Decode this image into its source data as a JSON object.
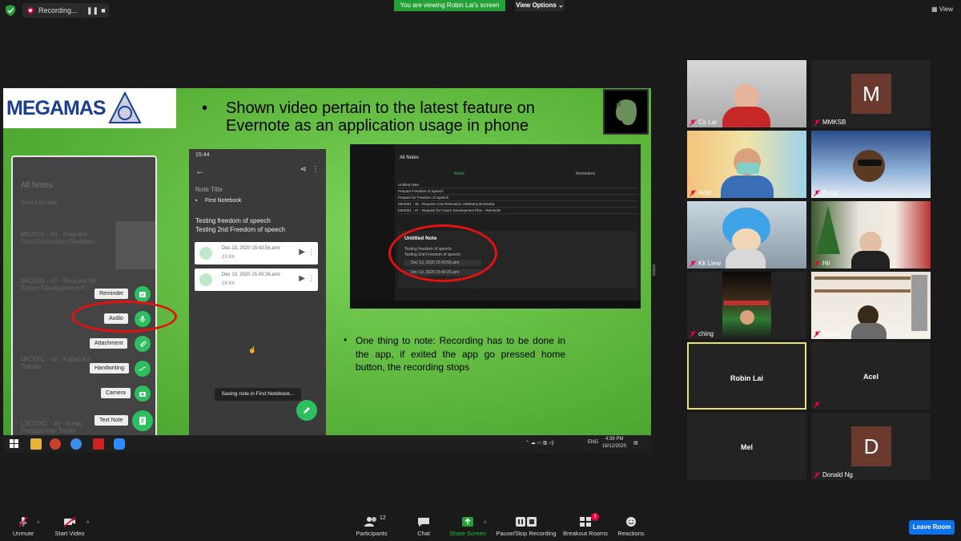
{
  "topbar": {
    "recording_label": "Recording...",
    "pause_glyph": "❚❚",
    "stop_glyph": "■",
    "viewing_banner": "You are viewing Robin Lai's screen",
    "view_options": "View Options ⌄",
    "view_label": "View"
  },
  "slide": {
    "logo_text": "MEGAMAS",
    "title_bullet": "•",
    "title_line1": "Shown video pertain to the latest feature on",
    "title_line2": "Evernote as an application usage in phone",
    "note_bullet": "•",
    "note_text": "One thing to note: Recording has to be done in the app, if exited the app go pressed home button, the recording stops",
    "left_phone": {
      "header": "All Notes",
      "sub": "Sorted by date",
      "items": [
        "MK2001 - 43 - Request Cost Relocation (Teaktom...",
        "MK2001 - 47 - Request for Future Development P...",
        "MK2001 - 46 - Kajian Ke Tekstar",
        "LSO2001 - 45 - Kerja Penggantian Tanah"
      ],
      "menu": [
        {
          "label": "Reminder",
          "icon": "reminder-icon"
        },
        {
          "label": "Audio",
          "icon": "microphone-icon"
        },
        {
          "label": "Attachment",
          "icon": "paperclip-icon"
        },
        {
          "label": "Handwriting",
          "icon": "handwriting-icon"
        },
        {
          "label": "Camera",
          "icon": "camera-icon"
        },
        {
          "label": "Text Note",
          "icon": "note-icon"
        }
      ]
    },
    "mid_phone": {
      "status_time": "15:44",
      "note_title": "Note Title",
      "notebook": "First Notebook",
      "body_line1": "Testing freedom of speech",
      "body_line2": "Testing 2nd Freedom of speech",
      "audio1": {
        "file": "Dec 13, 2020 15:43:56.amr",
        "size": "23 Kb"
      },
      "audio2": {
        "file": "Dec 13, 2020 15:43:26.amr",
        "size": "19 Kb"
      },
      "toast": "Saving note in First Notebook..."
    },
    "desktop_shot": {
      "title": "All Notes",
      "tabs": [
        "Notes",
        "Reminders"
      ],
      "rows": [
        "Untitled Note",
        "Prepare Freedom of Speech",
        "Prepare for Freedom of Speech",
        "MK2001 - 45 - Request Cost Relocation Udeteany Bumiraha",
        "MK2001 - 47 - Request for Future Development Plan - Reminder"
      ],
      "note_title": "Untitled Note",
      "note_line1": "Testing freedom of speech",
      "note_line2": "Testing 2nd Freedom of speech",
      "audio1": "Dec 13, 2020 15:43:56.amr",
      "audio2": "Dec 13, 2020 15:43:26.amr"
    },
    "taskbar": {
      "lang": "ENG",
      "time": "4:39 PM",
      "date": "16/12/2020"
    }
  },
  "gallery": {
    "tiles": [
      {
        "name": "Cs Lai",
        "type": "video",
        "muted": true
      },
      {
        "name": "MMKSB",
        "type": "avatar",
        "initial": "M",
        "muted": true
      },
      {
        "name": "Adel",
        "type": "video",
        "muted": true
      },
      {
        "name": "Bong",
        "type": "video",
        "muted": true
      },
      {
        "name": "Kk Liew",
        "type": "video",
        "muted": true
      },
      {
        "name": "Hii",
        "type": "video",
        "muted": true
      },
      {
        "name": "ching",
        "type": "video",
        "muted": true
      },
      {
        "name": "Nicole",
        "type": "video",
        "muted": true
      },
      {
        "name": "Robin Lai",
        "type": "name",
        "active": true,
        "muted": false
      },
      {
        "name": "Acel",
        "type": "name",
        "muted": true
      },
      {
        "name": "Mel",
        "type": "name",
        "muted": false
      },
      {
        "name": "Donald Ng",
        "type": "avatar",
        "initial": "D",
        "muted": true
      }
    ]
  },
  "bottombar": {
    "unmute": "Unmute",
    "start_video": "Start Video",
    "participants": "Participants",
    "participants_count": "12",
    "chat": "Chat",
    "share_screen": "Share Screen",
    "pause_stop": "Pause/Stop Recording",
    "breakout": "Breakout Rooms",
    "breakout_badge": "3",
    "reactions": "Reactions",
    "leave": "Leave Room"
  },
  "colors": {
    "zoom_green": "#23a137",
    "zoom_blue": "#0e72ed",
    "slide_green": "#5cb53a",
    "evernote_green": "#2dbe60",
    "highlight_red": "#e61010",
    "active_border": "#e8e26e"
  }
}
